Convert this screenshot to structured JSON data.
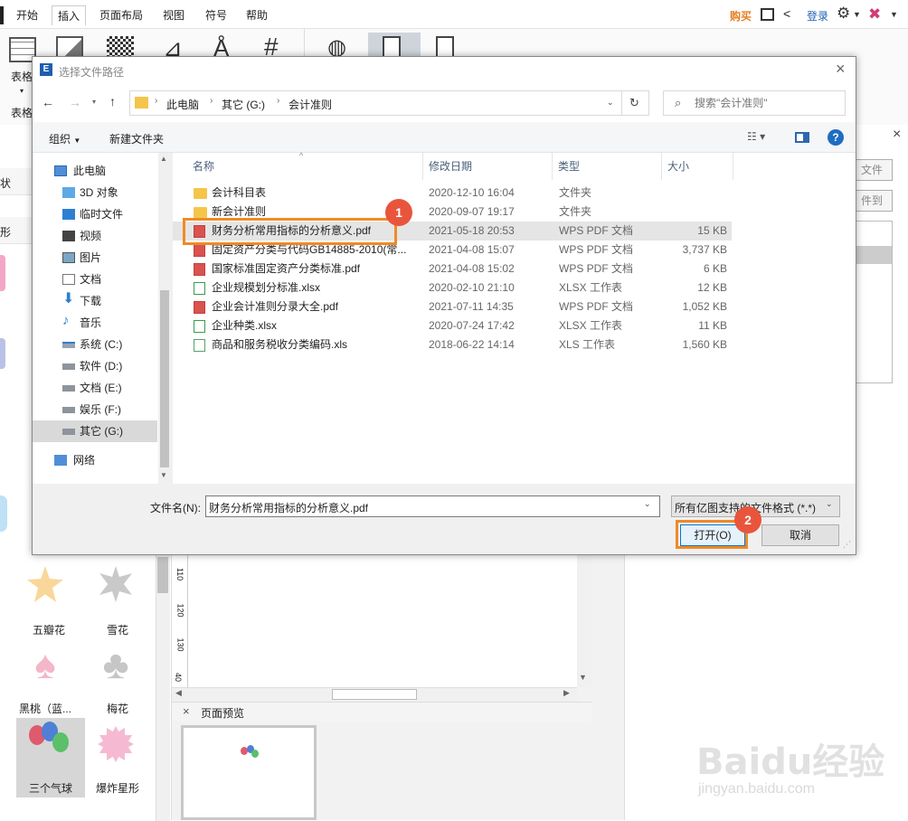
{
  "app": {
    "menu": {
      "tabs": [
        "开始",
        "插入",
        "页面布局",
        "视图",
        "符号",
        "帮助"
      ],
      "buy": "购买",
      "login": "登录"
    },
    "ribbon": {
      "table_label": "表格",
      "table_label2": "表格"
    },
    "left_panel": {
      "labels": [
        "状",
        "形"
      ],
      "shapes": [
        "五瓣花",
        "雪花",
        "黑桃（蓝...",
        "梅花",
        "三个气球",
        "爆炸星形"
      ]
    },
    "right_panel": {
      "btn1": "文件",
      "btn2": "件到"
    },
    "preview": {
      "title": "页面预览"
    },
    "ruler": [
      "110",
      "120",
      "130",
      "40"
    ]
  },
  "dialog": {
    "title": "选择文件路径",
    "breadcrumb": [
      "此电脑",
      "其它 (G:)",
      "会计准则"
    ],
    "search_placeholder": "搜索\"会计准则\"",
    "toolbar": {
      "organize": "组织",
      "new_folder": "新建文件夹"
    },
    "tree": [
      {
        "label": "此电脑",
        "icon": "computer-icon"
      },
      {
        "label": "3D 对象",
        "icon": "cube-icon"
      },
      {
        "label": "临时文件",
        "icon": "desktop-icon"
      },
      {
        "label": "视频",
        "icon": "video-icon"
      },
      {
        "label": "图片",
        "icon": "picture-icon"
      },
      {
        "label": "文档",
        "icon": "document-icon"
      },
      {
        "label": "下载",
        "icon": "download-icon"
      },
      {
        "label": "音乐",
        "icon": "music-icon"
      },
      {
        "label": "系统 (C:)",
        "icon": "drive-icon"
      },
      {
        "label": "软件 (D:)",
        "icon": "drive-icon"
      },
      {
        "label": "文档 (E:)",
        "icon": "drive-icon"
      },
      {
        "label": "娱乐 (F:)",
        "icon": "drive-icon"
      },
      {
        "label": "其它 (G:)",
        "icon": "drive-icon"
      },
      {
        "label": "网络",
        "icon": "network-icon"
      }
    ],
    "columns": [
      "名称",
      "修改日期",
      "类型",
      "大小"
    ],
    "files": [
      {
        "name": "会计科目表",
        "date": "2020-12-10 16:04",
        "type": "文件夹",
        "size": "",
        "kind": "folder"
      },
      {
        "name": "新会计准则",
        "date": "2020-09-07 19:17",
        "type": "文件夹",
        "size": "",
        "kind": "folder"
      },
      {
        "name": "财务分析常用指标的分析意义.pdf",
        "date": "2021-05-18 20:53",
        "type": "WPS PDF 文档",
        "size": "15 KB",
        "kind": "pdf"
      },
      {
        "name": "固定资产分类与代码GB14885-2010(常...",
        "date": "2021-04-08 15:07",
        "type": "WPS PDF 文档",
        "size": "3,737 KB",
        "kind": "pdf"
      },
      {
        "name": "国家标准固定资产分类标准.pdf",
        "date": "2021-04-08 15:02",
        "type": "WPS PDF 文档",
        "size": "6 KB",
        "kind": "pdf"
      },
      {
        "name": "企业规模划分标准.xlsx",
        "date": "2020-02-10 21:10",
        "type": "XLSX 工作表",
        "size": "12 KB",
        "kind": "xls"
      },
      {
        "name": "企业会计准则分录大全.pdf",
        "date": "2021-07-11 14:35",
        "type": "WPS PDF 文档",
        "size": "1,052 KB",
        "kind": "pdf"
      },
      {
        "name": "企业种类.xlsx",
        "date": "2020-07-24 17:42",
        "type": "XLSX 工作表",
        "size": "11 KB",
        "kind": "xls"
      },
      {
        "name": "商品和服务税收分类编码.xls",
        "date": "2018-06-22 14:14",
        "type": "XLS 工作表",
        "size": "1,560 KB",
        "kind": "xls2"
      }
    ],
    "filename_label": "文件名(N):",
    "filename_value": "财务分析常用指标的分析意义.pdf",
    "filter": "所有亿图支持的文件格式 (*.*)",
    "open_button": "打开(O)",
    "cancel_button": "取消",
    "badges": [
      "1",
      "2"
    ]
  },
  "watermark": {
    "brand": "Baidu经验",
    "url": "jingyan.baidu.com"
  },
  "colors": {
    "accent": "#f08a25",
    "badge": "#e8553c",
    "selected_row": "#e5e5e5",
    "ribbon_selected": "#cfd4dc"
  }
}
